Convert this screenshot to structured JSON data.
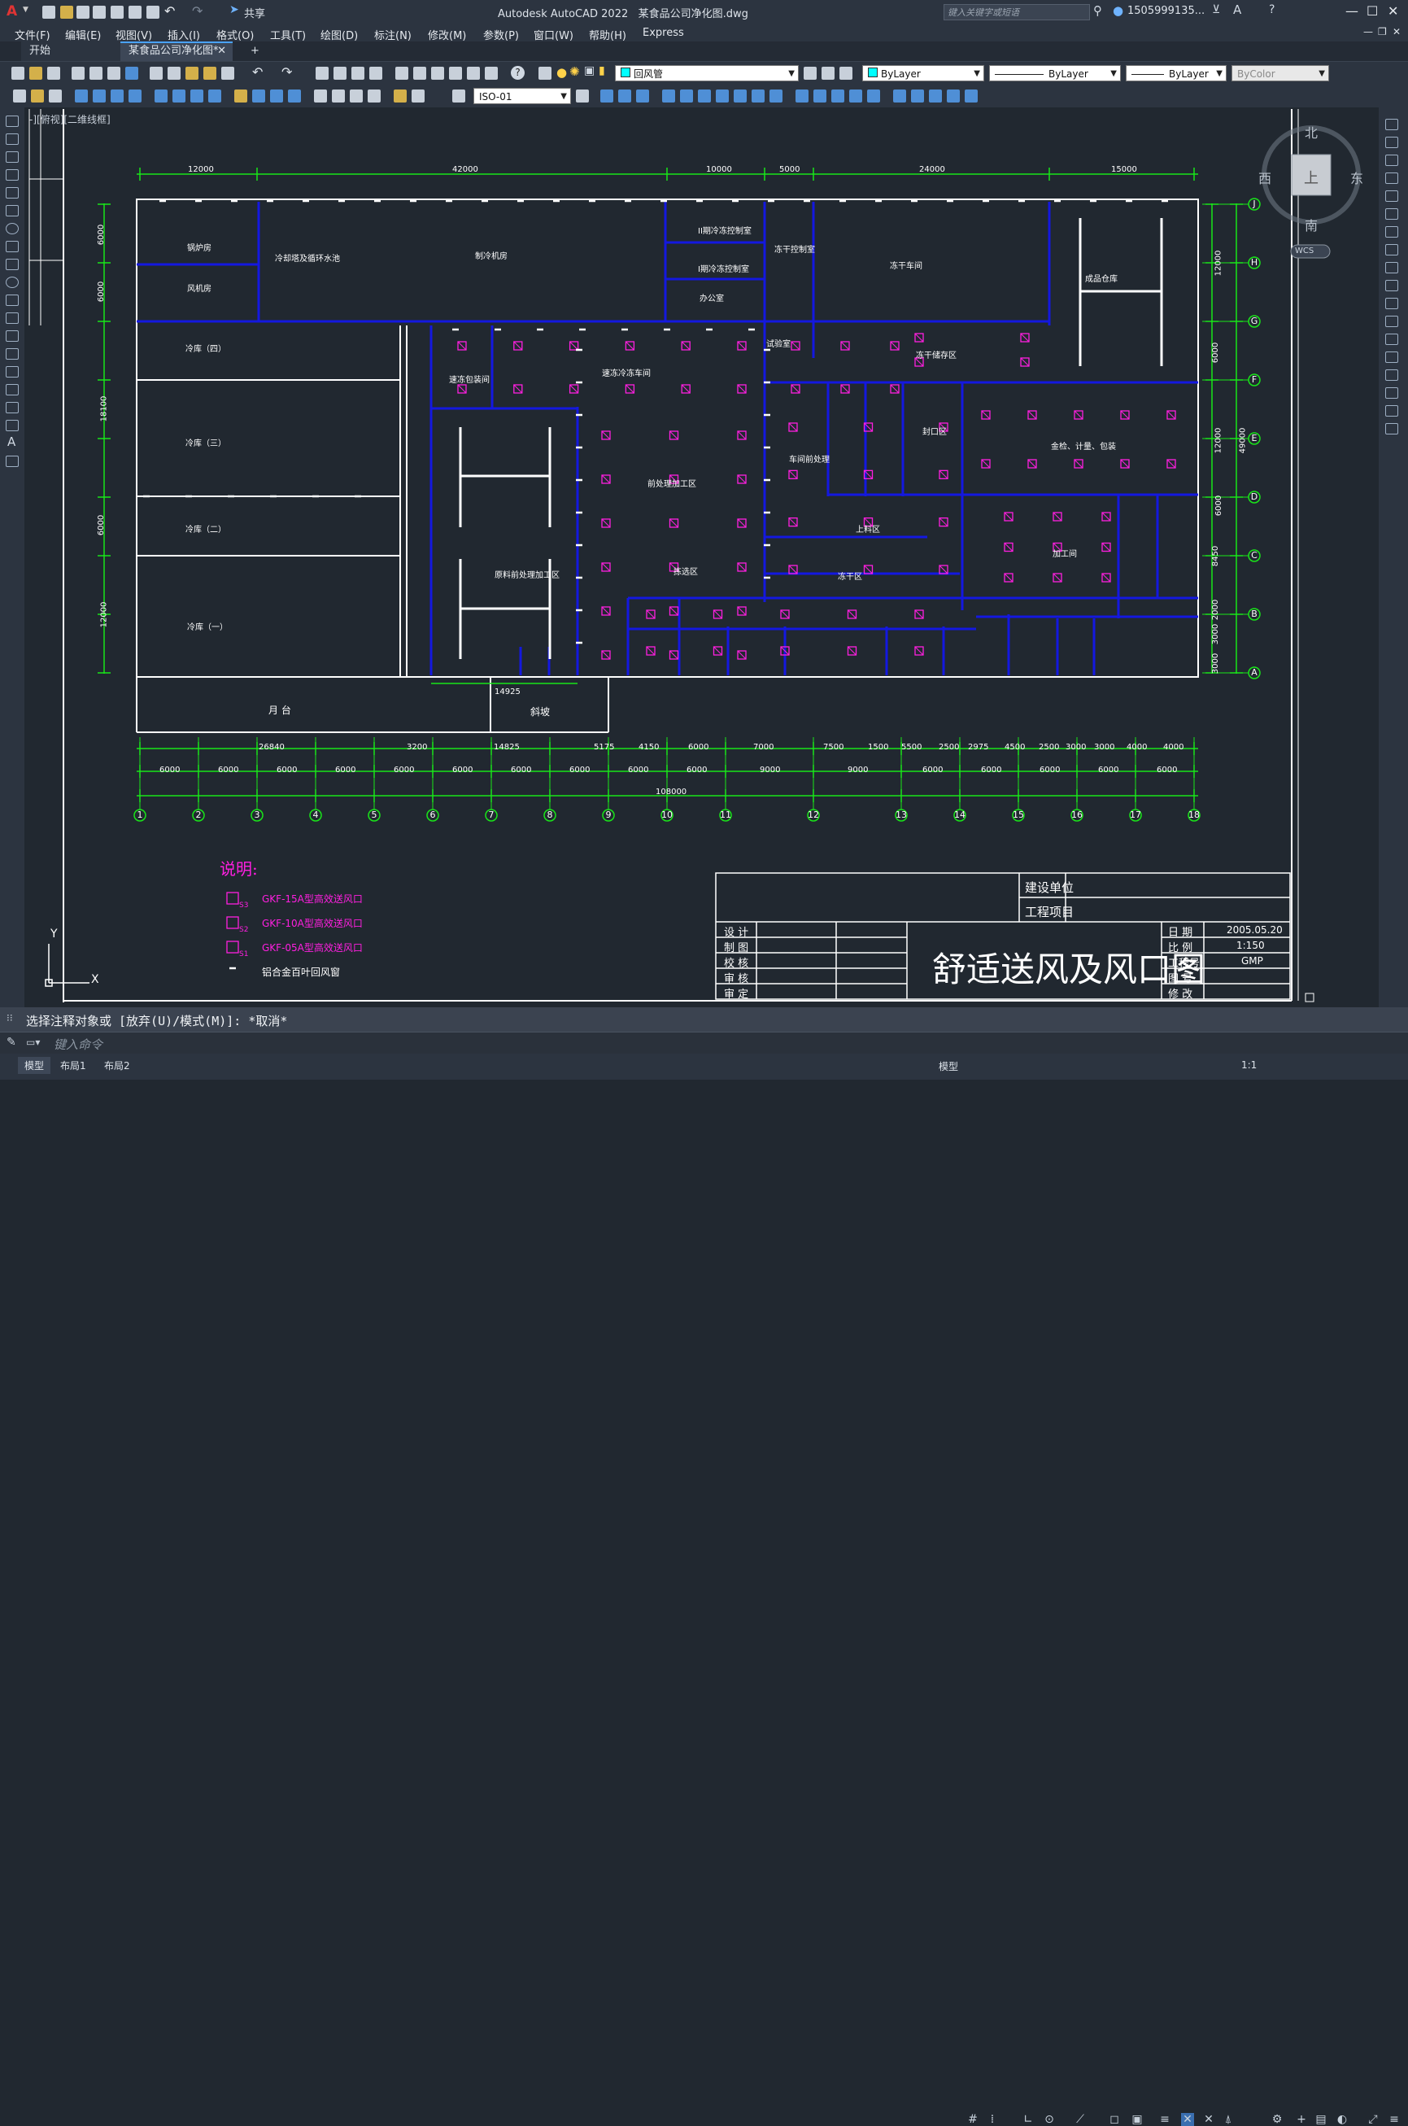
{
  "window": {
    "app_title": "Autodesk AutoCAD 2022",
    "file_title": "某食品公司净化图.dwg",
    "share_label": "共享",
    "search_placeholder": "键入关键字或短语",
    "user": "1505999135...",
    "min": "—",
    "max": "☐",
    "close": "✕"
  },
  "menu": [
    "文件(F)",
    "编辑(E)",
    "视图(V)",
    "插入(I)",
    "格式(O)",
    "工具(T)",
    "绘图(D)",
    "标注(N)",
    "修改(M)",
    "参数(P)",
    "窗口(W)",
    "帮助(H)",
    "Express"
  ],
  "tabs": {
    "start": "开始",
    "doc": "某食品公司净化图*",
    "add": "+"
  },
  "toolbar": {
    "layer_value": "回风管",
    "color_value": "ByLayer",
    "linetype_value": "ByLayer",
    "lineweight_value": "ByLayer",
    "plotstyle_value": "ByColor",
    "dimstyle_value": "ISO-01"
  },
  "viewport_label": "-][俯视][二维线框]",
  "viewcube": {
    "north": "北",
    "south": "南",
    "east": "东",
    "west": "西",
    "top": "上",
    "wcs": "WCS"
  },
  "ucs": {
    "x": "X",
    "y": "Y"
  },
  "drawing": {
    "top_dims": [
      "12000",
      "42000",
      "10000",
      "5000",
      "24000",
      "15000"
    ],
    "left_dims": [
      "6000",
      "6000",
      "18100",
      "6000",
      "12000"
    ],
    "right_dims": [
      "12000",
      "6000",
      "12000",
      "49000",
      "6000",
      "8450",
      "2000",
      "3000",
      "3000"
    ],
    "row_labels": [
      "J",
      "H",
      "G",
      "F",
      "E",
      "D",
      "C",
      "B",
      "A"
    ],
    "column_labels": [
      "1",
      "2",
      "3",
      "4",
      "5",
      "6",
      "7",
      "8",
      "9",
      "10",
      "11",
      "12",
      "13",
      "14",
      "15",
      "16",
      "17",
      "18"
    ],
    "bottom_dims_1": [
      "26840",
      "3200",
      "14825",
      "5175",
      "4150",
      "6000",
      "7000",
      "7500",
      "1500",
      "5500",
      "2500",
      "2975",
      "4500",
      "2500",
      "3000",
      "3000",
      "4000",
      "4000"
    ],
    "bottom_dims_2": [
      "6000",
      "6000",
      "6000",
      "6000",
      "6000",
      "6000",
      "6000",
      "6000",
      "6000",
      "6000",
      "9000",
      "9000",
      "6000",
      "6000",
      "6000",
      "6000",
      "6000"
    ],
    "total_dim": "108000",
    "dock_dim": "14925",
    "rooms": {
      "boiler": "锅炉房",
      "fan_room": "风机房",
      "chiller": "冷却塔及循环水池",
      "refrig": "制冷机房",
      "cold4": "冷库（四）",
      "cold3": "冷库（三）",
      "cold2": "冷库（二）",
      "cold1": "冷库（一）",
      "platform": "月 台",
      "ramp": "斜坡",
      "office": "办公室",
      "ctrl1": "II期冷冻控制室",
      "ctrl2": "I期冷冻控制室",
      "freezer_ctrl": "冻干控制室",
      "warehouse": "冻干车间",
      "finished": "成品仓库",
      "pre": "前处理加工区",
      "raw": "原料前处理加工区",
      "cold_room": "速冻冷冻车间",
      "packing": "速冻包装间",
      "sorting": "拣选区",
      "weigh": "金检、计量、包装",
      "sealing": "封口区",
      "fry": "上料区",
      "freeze_dry": "冻干区",
      "machine": "车间前处理",
      "process": "加工间",
      "store": "冻干储存区",
      "lab": "试验室"
    },
    "legend": {
      "title": "说明:",
      "items": [
        "GKF-15A型高效送风口",
        "GKF-10A型高效送风口",
        "GKF-05A型高效送风口",
        "铝合金百叶回风窗"
      ],
      "subs": [
        "S3",
        "S2",
        "S1",
        ""
      ]
    },
    "titleblock": {
      "builder": "建设单位",
      "project": "工程项目",
      "rows_left": [
        "设 计",
        "制 图",
        "校 核",
        "审 核",
        "审 定"
      ],
      "big_title": "舒适送风及风口图",
      "date_label": "日 期",
      "date_value": "2005.05.20",
      "scale_label": "比 例",
      "scale_value": "1:150",
      "proj_label": "工程号",
      "proj_value": "GMP",
      "fig_label": "图 号",
      "ver_label": "修 改"
    }
  },
  "command": {
    "history": "选择注释对象或 [放弃(U)/模式(M)]: *取消*",
    "placeholder": "键入命令"
  },
  "status": {
    "tabs": [
      "模型",
      "布局1",
      "布局2"
    ],
    "model_label": "模型",
    "scale": "1:1"
  },
  "colors": {
    "wall": "#1418e0",
    "dim": "#19e619",
    "diffuser": "#ff1fe0",
    "white": "#ffffff"
  }
}
